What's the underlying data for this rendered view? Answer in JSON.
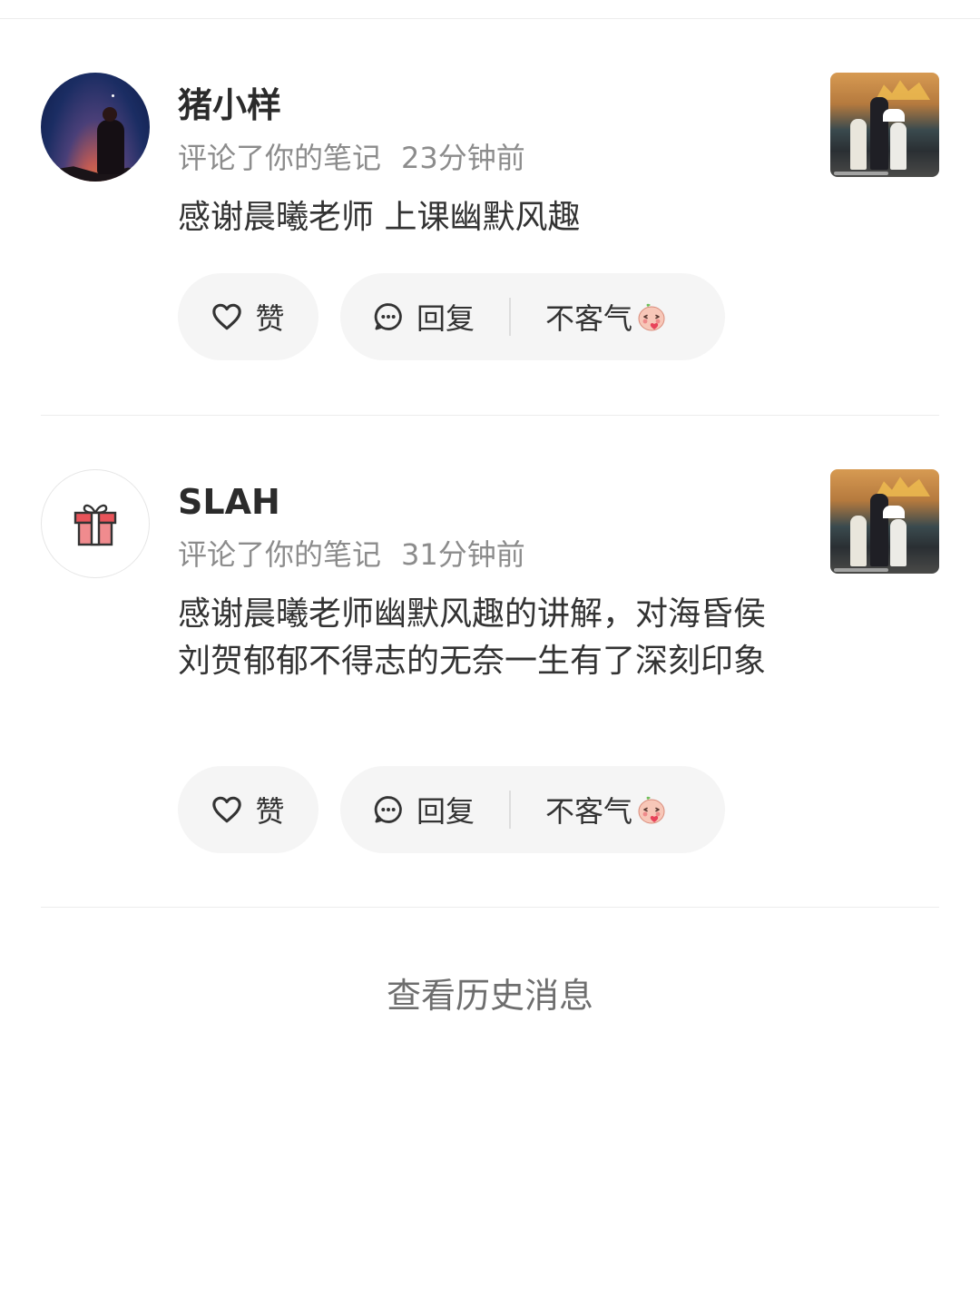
{
  "notifications": [
    {
      "user_name": "猪小样",
      "action_text": "评论了你的笔记",
      "time": "23分钟前",
      "comment": "感谢晨曦老师 上课幽默风趣",
      "avatar": "sunset-mountain-avatar",
      "like_label": "赞",
      "reply_label": "回复",
      "quick_reply": "不客气"
    },
    {
      "user_name": "SLAH",
      "action_text": "评论了你的笔记",
      "time": "31分钟前",
      "comment": "感谢晨曦老师幽默风趣的讲解，对海昏侯刘贺郁郁不得志的无奈一生有了深刻印象",
      "avatar": "gift-icon",
      "like_label": "赞",
      "reply_label": "回复",
      "quick_reply": "不客气"
    }
  ],
  "footer": {
    "history_label": "查看历史消息"
  },
  "icons": {
    "like": "heart-outline-icon",
    "reply": "chat-bubble-icon",
    "emoji": "kiss-face-emoji"
  },
  "colors": {
    "pill_bg": "#f5f5f5",
    "meta_text": "#8c8c8c",
    "gift_red": "#e8545a"
  }
}
